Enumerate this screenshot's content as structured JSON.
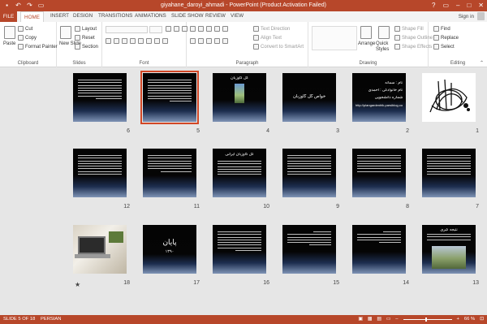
{
  "window": {
    "title": "giyahane_daroyi_ahmadi - PowerPoint (Product Activation Failed)",
    "controls": [
      "?",
      "▭",
      "–",
      "□",
      "✕"
    ]
  },
  "qat": [
    "save-icon",
    "undo-icon",
    "redo-icon",
    "present-icon"
  ],
  "tabs": [
    "FILE",
    "HOME",
    "INSERT",
    "DESIGN",
    "TRANSITIONS",
    "ANIMATIONS",
    "SLIDE SHOW",
    "REVIEW",
    "VIEW"
  ],
  "active_tab": "HOME",
  "account": {
    "signin": "Sign in"
  },
  "ribbon": {
    "clipboard": {
      "paste": "Paste",
      "cut": "Cut",
      "copy": "Copy",
      "format_painter": "Format Painter",
      "label": "Clipboard"
    },
    "slides": {
      "new_slide": "New Slide",
      "layout": "Layout",
      "reset": "Reset",
      "section": "Section",
      "label": "Slides"
    },
    "font": {
      "label": "Font"
    },
    "paragraph": {
      "text_direction": "Text Direction",
      "align_text": "Align Text",
      "convert_smartart": "Convert to SmartArt",
      "label": "Paragraph"
    },
    "drawing": {
      "arrange": "Arrange",
      "quick_styles": "Quick Styles",
      "shape_fill": "Shape Fill",
      "shape_outline": "Shape Outline",
      "shape_effects": "Shape Effects",
      "label": "Drawing"
    },
    "editing": {
      "find": "Find",
      "replace": "Replace",
      "select": "Select",
      "label": "Editing"
    }
  },
  "slides": [
    {
      "number": "1",
      "kind": "calligraphy"
    },
    {
      "number": "2",
      "kind": "title-info",
      "lines": [
        "نام : سمانه",
        "نام خانوادگی : احمدی",
        "شماره دانشجویی",
        "http://plangardenhtk.parsiblog.com"
      ]
    },
    {
      "number": "3",
      "kind": "title",
      "text": "خواص گل گاوزبان"
    },
    {
      "number": "4",
      "kind": "picture-title",
      "text": "گل گاوزبان"
    },
    {
      "number": "5",
      "kind": "text",
      "selected": true
    },
    {
      "number": "6",
      "kind": "text"
    },
    {
      "number": "7",
      "kind": "text"
    },
    {
      "number": "8",
      "kind": "text"
    },
    {
      "number": "9",
      "kind": "text"
    },
    {
      "number": "10",
      "kind": "text-heading",
      "text": "گل گاوزبان ایرانی"
    },
    {
      "number": "11",
      "kind": "text"
    },
    {
      "number": "12",
      "kind": "text"
    },
    {
      "number": "13",
      "kind": "picture-bottom",
      "text": "نتیجه گیری"
    },
    {
      "number": "14",
      "kind": "text-short"
    },
    {
      "number": "15",
      "kind": "text-short"
    },
    {
      "number": "16",
      "kind": "text"
    },
    {
      "number": "17",
      "kind": "end",
      "text": "پایان",
      "sub": "۱۳۹۰"
    },
    {
      "number": "18",
      "kind": "laptop",
      "star": "★"
    }
  ],
  "statusbar": {
    "slide_info": "SLIDE 5 OF 18",
    "language": "PERSIAN",
    "zoom": "66 %"
  }
}
